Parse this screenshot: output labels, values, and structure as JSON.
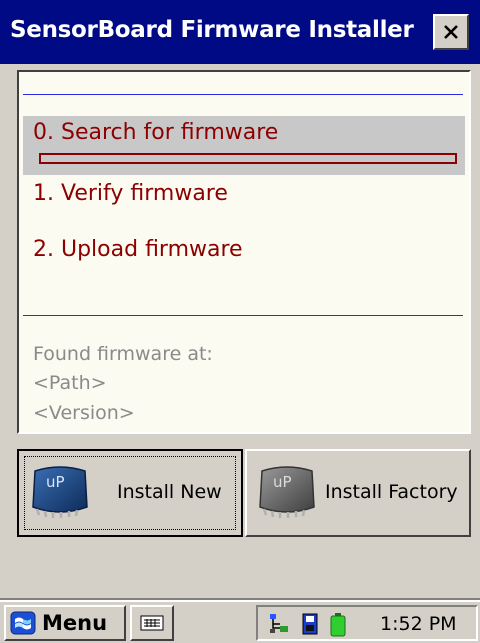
{
  "window": {
    "title": "SensorBoard Firmware Installer",
    "close_label": "✕"
  },
  "steps": [
    {
      "label": "0.  Search for firmware",
      "active": true
    },
    {
      "label": "1.  Verify firmware",
      "active": false
    },
    {
      "label": "2.  Upload firmware",
      "active": false
    }
  ],
  "progress": {
    "value": 0
  },
  "info": {
    "line1": "Found firmware at:",
    "line2": "<Path>",
    "line3": "<Version>"
  },
  "buttons": {
    "install_new": {
      "label": "Install New",
      "icon": "chip-icon",
      "chip_text": "uP"
    },
    "install_factory": {
      "label": "Install Factory",
      "icon": "chip-icon-gray",
      "chip_text": "uP"
    }
  },
  "taskbar": {
    "menu_label": "Menu",
    "clock": "1:52 PM"
  },
  "colors": {
    "title_bar": "#000a84",
    "step_text": "#8b0000",
    "panel_bg": "#fbfbf1",
    "info_text": "#8a8a8a"
  }
}
